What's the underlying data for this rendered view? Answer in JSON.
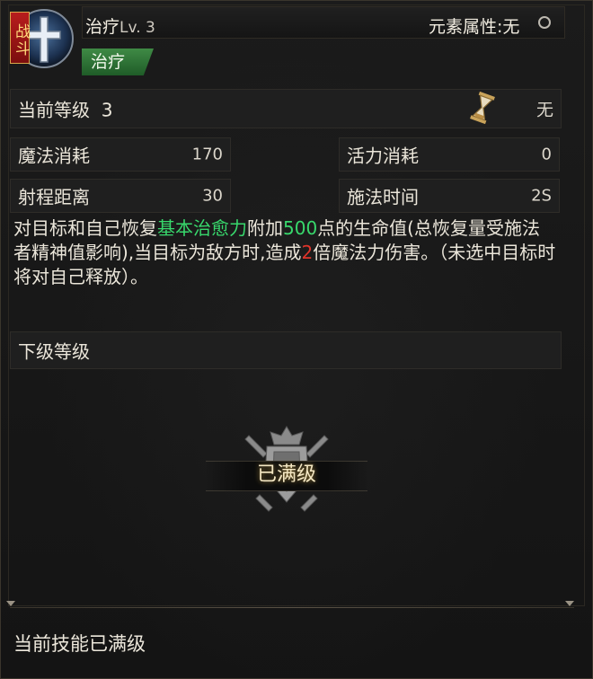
{
  "header": {
    "badge": "战斗",
    "skill_name": "治疗",
    "skill_level": "Lv. 3",
    "element_attribute": "元素属性:无",
    "category_tag": "治疗"
  },
  "current_level": {
    "label": "当前等级",
    "value": "3",
    "cooldown_value": "无"
  },
  "stats": {
    "mana_cost_label": "魔法消耗",
    "mana_cost_value": "170",
    "vitality_cost_label": "活力消耗",
    "vitality_cost_value": "0",
    "range_label": "射程距离",
    "range_value": "30",
    "cast_time_label": "施法时间",
    "cast_time_value": "2S"
  },
  "description": {
    "part1": "对目标和自己恢复",
    "highlight1": "基本治愈力",
    "part2": "附加",
    "highlight2": "500",
    "part3": "点的生命值(总恢复量受施法者精神值影响),当目标为敌方时,造成",
    "highlight3": "2",
    "part4": "倍魔法力伤害。（未选中目标时将对自己释放）。"
  },
  "next_level": {
    "label": "下级等级"
  },
  "maxed": {
    "label": "已满级"
  },
  "footer": {
    "text": "当前技能已满级"
  },
  "icons": [
    "cross-skill-icon",
    "hourglass-icon",
    "circle-icon",
    "crest-emblem-icon"
  ],
  "colors": {
    "highlight_green": "#38d86c",
    "highlight_red": "#e0342a",
    "category_tag": "#2f7a3a",
    "badge_red": "#a01818"
  }
}
